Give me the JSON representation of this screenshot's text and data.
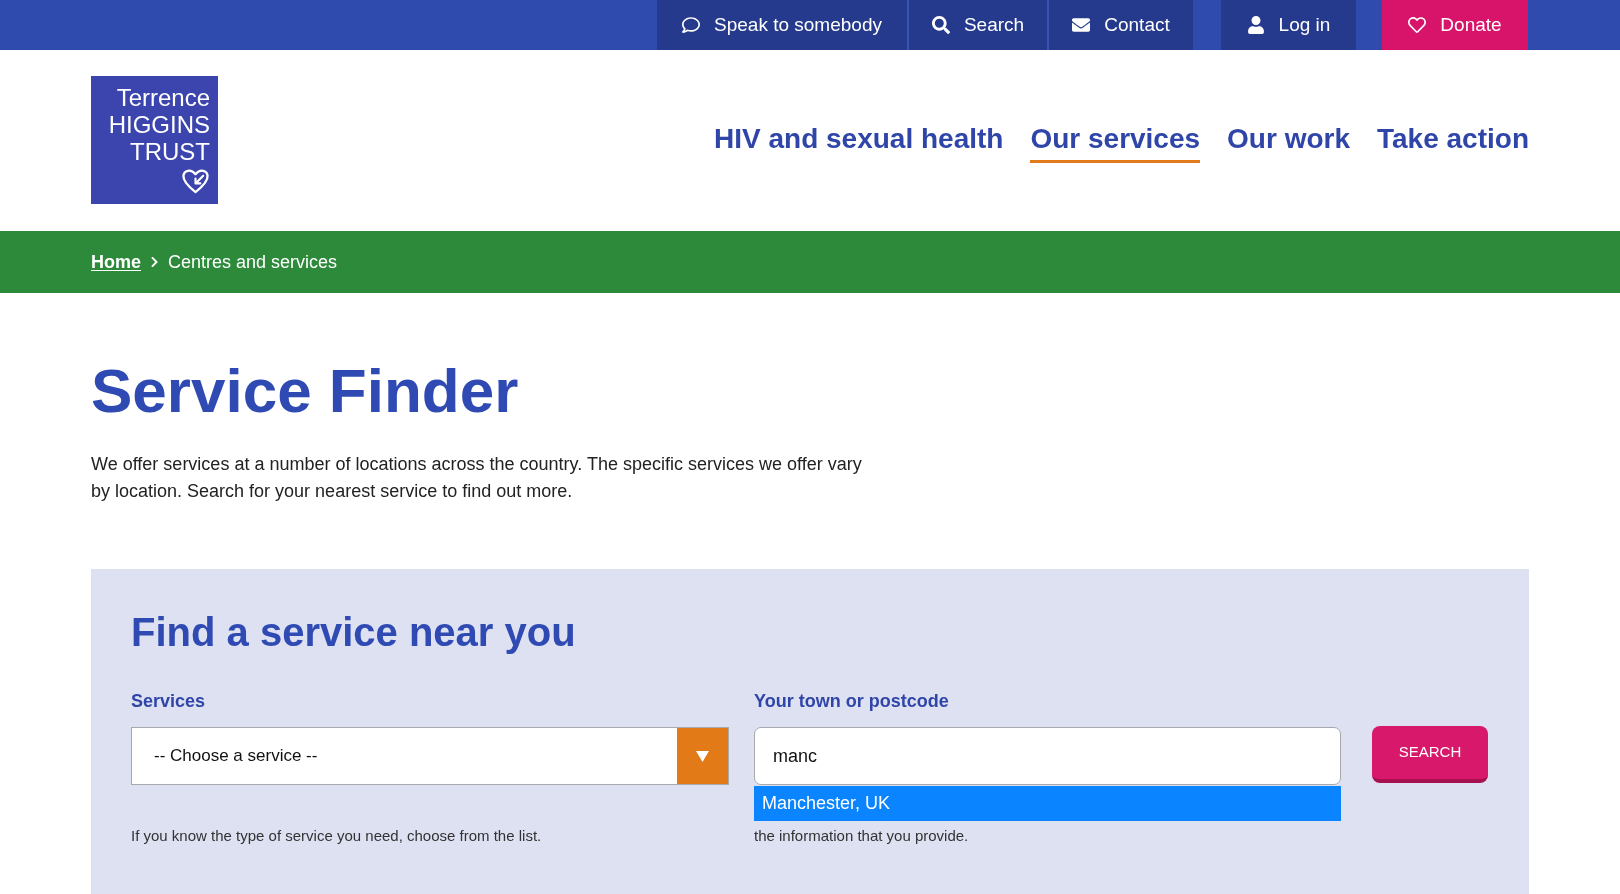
{
  "top_bar": {
    "links": [
      {
        "kind": "chat",
        "label": "Speak to somebody"
      },
      {
        "kind": "search",
        "label": "Search"
      },
      {
        "kind": "contact",
        "label": "Contact"
      },
      {
        "kind": "account",
        "label": "Log in"
      },
      {
        "kind": "donate",
        "label": "Donate"
      }
    ]
  },
  "logo": {
    "lines": [
      "Terrence",
      "HIGGINS",
      "TRUST"
    ]
  },
  "main_nav": [
    {
      "label": "HIV and sexual health",
      "selected": false
    },
    {
      "label": "Our services",
      "selected": true
    },
    {
      "label": "Our work",
      "selected": false
    },
    {
      "label": "Take action",
      "selected": false
    }
  ],
  "breadcrumb": [
    {
      "kind": "link",
      "label": "Home"
    },
    {
      "kind": "current",
      "label": "Centres and services"
    }
  ],
  "page": {
    "title": "Service Finder",
    "intro": "We offer services at a number of locations across the country. The specific services we offer vary by location. Search for your nearest service to find out more."
  },
  "finder": {
    "title": "Find a service near you",
    "services": {
      "label": "Services",
      "value": "-- Choose a service --",
      "help": "If you know the type of service you need, choose from the list."
    },
    "location": {
      "label": "Your town or postcode",
      "value": "manc",
      "suggestions": [
        {
          "label": "Manchester, UK",
          "selected": true
        }
      ],
      "help": "the information that you provide."
    },
    "search_button": {
      "label": "SEARCH"
    }
  }
}
